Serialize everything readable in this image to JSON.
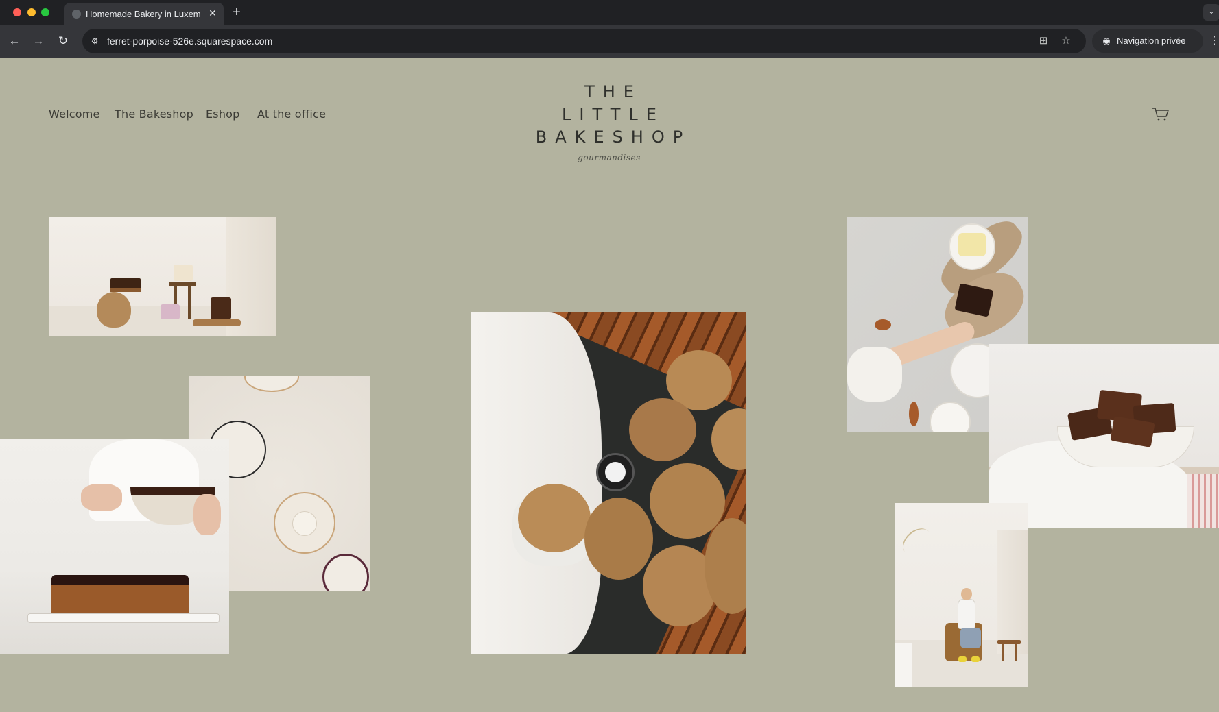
{
  "browser": {
    "tab_title": "Homemade Bakery in Luxembourg",
    "new_tab_symbol": "+",
    "close_symbol": "✕",
    "url": "ferret-porpoise-526e.squarespace.com",
    "incognito_label": "Navigation privée"
  },
  "site": {
    "nav": [
      {
        "label": "Welcome",
        "active": true
      },
      {
        "label": "The Bakeshop",
        "active": false
      },
      {
        "label": "Eshop",
        "active": false
      },
      {
        "label": "At the office",
        "active": false
      }
    ],
    "logo": {
      "line1": "THE LITTLE",
      "line2": "BAKESHOP",
      "script": "gourmandises"
    },
    "cart_icon": "cart-icon"
  },
  "gallery": [
    {
      "subject": "cakes-on-wooden-stools"
    },
    {
      "subject": "ceramic-plates"
    },
    {
      "subject": "chocolate-glazed-loaf"
    },
    {
      "subject": "cookies-on-baking-tray"
    },
    {
      "subject": "hand-with-chocolate-pieces"
    },
    {
      "subject": "brownies-in-bowl"
    },
    {
      "subject": "baker-in-chair"
    }
  ],
  "colors": {
    "page_background": "#b3b39f",
    "text": "#3b3b35",
    "chrome_dark": "#202124",
    "chrome_toolbar": "#35363a"
  }
}
